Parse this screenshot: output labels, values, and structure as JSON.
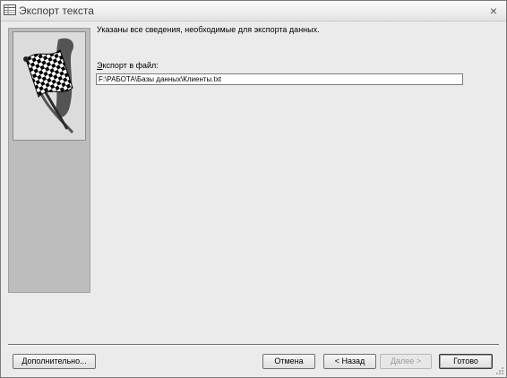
{
  "window": {
    "title": "Экспорт текста",
    "close_glyph": "×"
  },
  "icons": {
    "title": "table-export-icon",
    "close": "close-icon",
    "illustration": "checkered-flag-icon",
    "grip": "resize-grip-icon"
  },
  "main": {
    "headline": "Указаны все сведения, необходимые для экспорта данных.",
    "export_label_accesskey": "Э",
    "export_label_rest": "кспорт в файл:",
    "file_path": "F:\\РАБОТА\\Базы данных\\Клиенты.txt"
  },
  "buttons": {
    "advanced": "Дополнительно...",
    "cancel": "Отмена",
    "back": "< Назад",
    "next": "Далее >",
    "finish": "Готово"
  }
}
